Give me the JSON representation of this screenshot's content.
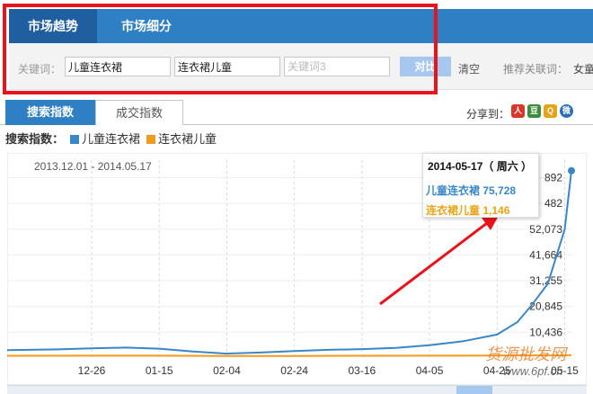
{
  "tabs": {
    "active": "市场趋势",
    "other": "市场细分"
  },
  "keywords": {
    "label": "关键词：",
    "kw1": "儿童连衣裙",
    "kw2": "连衣裙儿童",
    "kw3_placeholder": "关键词3",
    "compare": "对比",
    "clear": "清空",
    "recommend_label": "推荐关联词：",
    "recommend_value": "女童连"
  },
  "subtabs": {
    "active": "搜索指数",
    "other": "成交指数"
  },
  "share": {
    "label": "分享到：",
    "icons": [
      "renren-icon",
      "douban-icon",
      "qzone-icon",
      "sina-icon"
    ]
  },
  "legend": {
    "title": "搜索指数：",
    "s1": "儿童连衣裙",
    "s2": "连衣裙儿童"
  },
  "colors": {
    "s1": "#3a87c7",
    "s2": "#f29a1b",
    "accent": "#2f7fc4",
    "highlight": "#e8141b"
  },
  "tooltip": {
    "date": "2014-05-17（ 周六 ）",
    "s1": "儿童连衣裙 75,728",
    "s2": "连衣裙儿童 1,146"
  },
  "watermark": "货源批发网",
  "watermark2": "www.6pf.cn",
  "chart_data": {
    "type": "line",
    "title": "",
    "range_label": "2013.12.01 - 2014.05.17",
    "x_ticks": [
      "12-26",
      "01-15",
      "02-04",
      "02-24",
      "03-16",
      "04-05",
      "04-25",
      "05-15"
    ],
    "y_ticks": [
      "10,436",
      "20,845",
      "31,255",
      "41,664",
      "52,073",
      "482",
      "892"
    ],
    "y_axis_side": "right",
    "grid": true,
    "series": [
      {
        "name": "儿童连衣裙",
        "x": [
          "2013-12-01",
          "2013-12-16",
          "2013-12-26",
          "2014-01-05",
          "2014-01-15",
          "2014-01-25",
          "2014-02-04",
          "2014-02-14",
          "2014-02-24",
          "2014-03-06",
          "2014-03-16",
          "2014-03-26",
          "2014-04-05",
          "2014-04-15",
          "2014-04-25",
          "2014-05-01",
          "2014-05-05",
          "2014-05-10",
          "2014-05-15",
          "2014-05-17"
        ],
        "values": [
          3200,
          3500,
          3900,
          4200,
          3800,
          2600,
          1800,
          2200,
          2800,
          3300,
          3600,
          4100,
          5200,
          6800,
          9500,
          14500,
          21000,
          30000,
          52000,
          75728
        ]
      },
      {
        "name": "连衣裙儿童",
        "x": [
          "2013-12-01",
          "2013-12-26",
          "2014-01-15",
          "2014-02-04",
          "2014-02-24",
          "2014-03-16",
          "2014-04-05",
          "2014-04-25",
          "2014-05-15",
          "2014-05-17"
        ],
        "values": [
          900,
          950,
          950,
          800,
          850,
          900,
          950,
          1000,
          1100,
          1146
        ]
      }
    ]
  }
}
